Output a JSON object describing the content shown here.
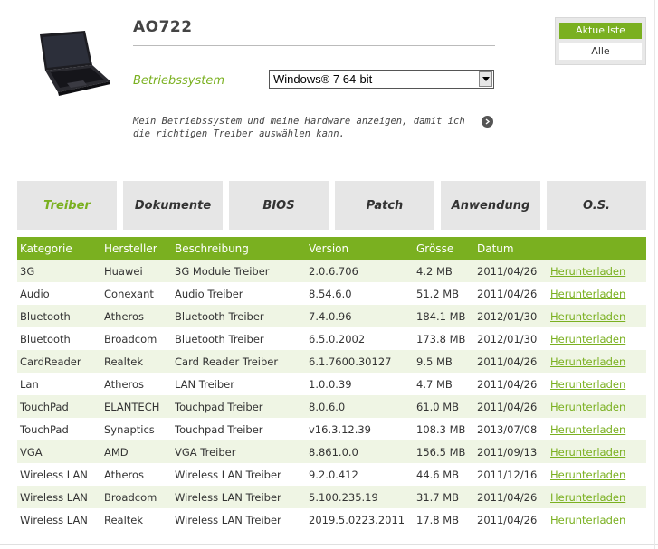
{
  "product": {
    "model": "AO722",
    "image_icon": "laptop-image"
  },
  "os_selector": {
    "label": "Betriebssystem",
    "selected": "Windows® 7 64-bit"
  },
  "hint_text": "Mein Betriebssystem und meine Hardware anzeigen, damit ich die richtigen Treiber auswählen kann.",
  "filter": {
    "latest_label": "Aktuellste",
    "all_label": "Alle"
  },
  "tabs": [
    {
      "label": "Treiber",
      "active": true
    },
    {
      "label": "Dokumente",
      "active": false
    },
    {
      "label": "BIOS",
      "active": false
    },
    {
      "label": "Patch",
      "active": false
    },
    {
      "label": "Anwendung",
      "active": false
    },
    {
      "label": "O.S.",
      "active": false
    }
  ],
  "table": {
    "headers": [
      "Kategorie",
      "Hersteller",
      "Beschreibung",
      "Version",
      "Grösse",
      "Datum",
      ""
    ],
    "download_label": "Herunterladen",
    "rows": [
      [
        "3G",
        "Huawei",
        "3G Module Treiber",
        "2.0.6.706",
        "4.2 MB",
        "2011/04/26"
      ],
      [
        "Audio",
        "Conexant",
        "Audio Treiber",
        "8.54.6.0",
        "51.2 MB",
        "2011/04/26"
      ],
      [
        "Bluetooth",
        "Atheros",
        "Bluetooth Treiber",
        "7.4.0.96",
        "184.1 MB",
        "2012/01/30"
      ],
      [
        "Bluetooth",
        "Broadcom",
        "Bluetooth Treiber",
        "6.5.0.2002",
        "173.8 MB",
        "2012/01/30"
      ],
      [
        "CardReader",
        "Realtek",
        "Card Reader Treiber",
        "6.1.7600.30127",
        "9.5 MB",
        "2011/04/26"
      ],
      [
        "Lan",
        "Atheros",
        "LAN Treiber",
        "1.0.0.39",
        "4.7 MB",
        "2011/04/26"
      ],
      [
        "TouchPad",
        "ELANTECH",
        "Touchpad Treiber",
        "8.0.6.0",
        "61.0 MB",
        "2011/04/26"
      ],
      [
        "TouchPad",
        "Synaptics",
        "Touchpad Treiber",
        "v16.3.12.39",
        "108.3 MB",
        "2013/07/08"
      ],
      [
        "VGA",
        "AMD",
        "VGA Treiber",
        "8.861.0.0",
        "156.5 MB",
        "2011/09/13"
      ],
      [
        "Wireless LAN",
        "Atheros",
        "Wireless LAN Treiber",
        "9.2.0.412",
        "44.6 MB",
        "2011/12/16"
      ],
      [
        "Wireless LAN",
        "Broadcom",
        "Wireless LAN Treiber",
        "5.100.235.19",
        "31.7 MB",
        "2011/04/26"
      ],
      [
        "Wireless LAN",
        "Realtek",
        "Wireless LAN Treiber",
        "2019.5.0223.2011",
        "17.8 MB",
        "2011/04/26"
      ]
    ]
  },
  "colors": {
    "accent": "#7ab020",
    "row_alt": "#eff5e4",
    "tab_bg": "#e6e6e6"
  }
}
